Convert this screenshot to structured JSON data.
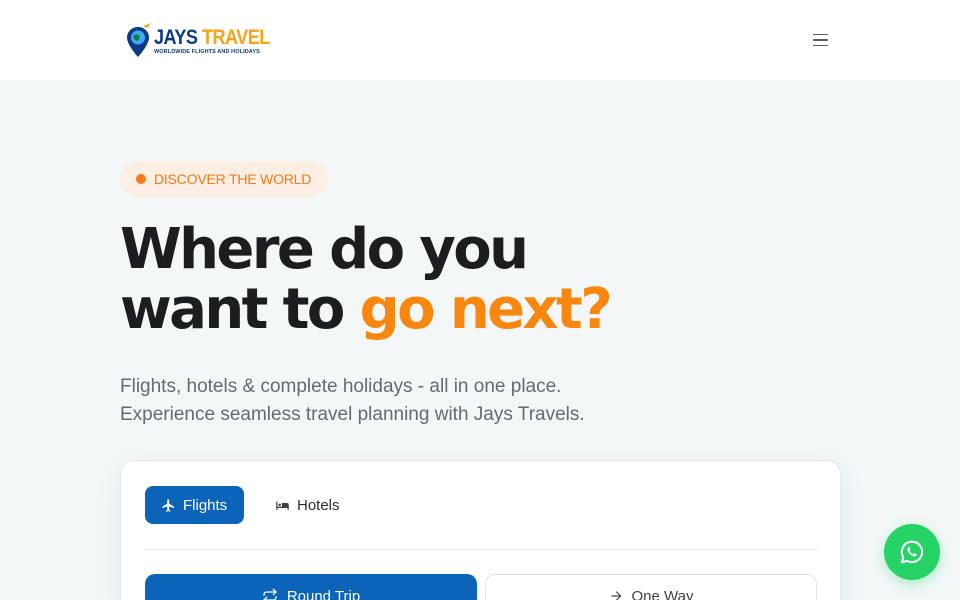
{
  "header": {
    "logo": {
      "name_part1": "JAYS ",
      "name_part2": "TRAVEL",
      "tagline": "WORLDWIDE FLIGHTS AND HOLIDAYS",
      "icon": "location-pin-plane-icon"
    },
    "menu_icon": "hamburger-menu-icon"
  },
  "hero": {
    "badge": "DISCOVER THE WORLD",
    "headline_line1": "Where do you",
    "headline_line2_plain": "want to ",
    "headline_line2_accent": "go next?",
    "subtitle_line1": "Flights, hotels & complete holidays - all in one place.",
    "subtitle_line2": "Experience seamless travel planning with Jays Travels."
  },
  "search": {
    "tabs": [
      {
        "label": "Flights",
        "icon": "plane-icon",
        "active": true
      },
      {
        "label": "Hotels",
        "icon": "bed-icon",
        "active": false
      }
    ],
    "trip_types": [
      {
        "label": "Round Trip",
        "icon": "repeat-icon",
        "active": true
      },
      {
        "label": "One Way",
        "icon": "arrow-right-icon",
        "active": false
      }
    ]
  },
  "floating": {
    "whatsapp_icon": "whatsapp-icon"
  },
  "colors": {
    "brand_blue": "#0b64b8",
    "accent_orange": "#f7870f",
    "whatsapp_green": "#25d366",
    "page_background": "#f3f7f8"
  }
}
